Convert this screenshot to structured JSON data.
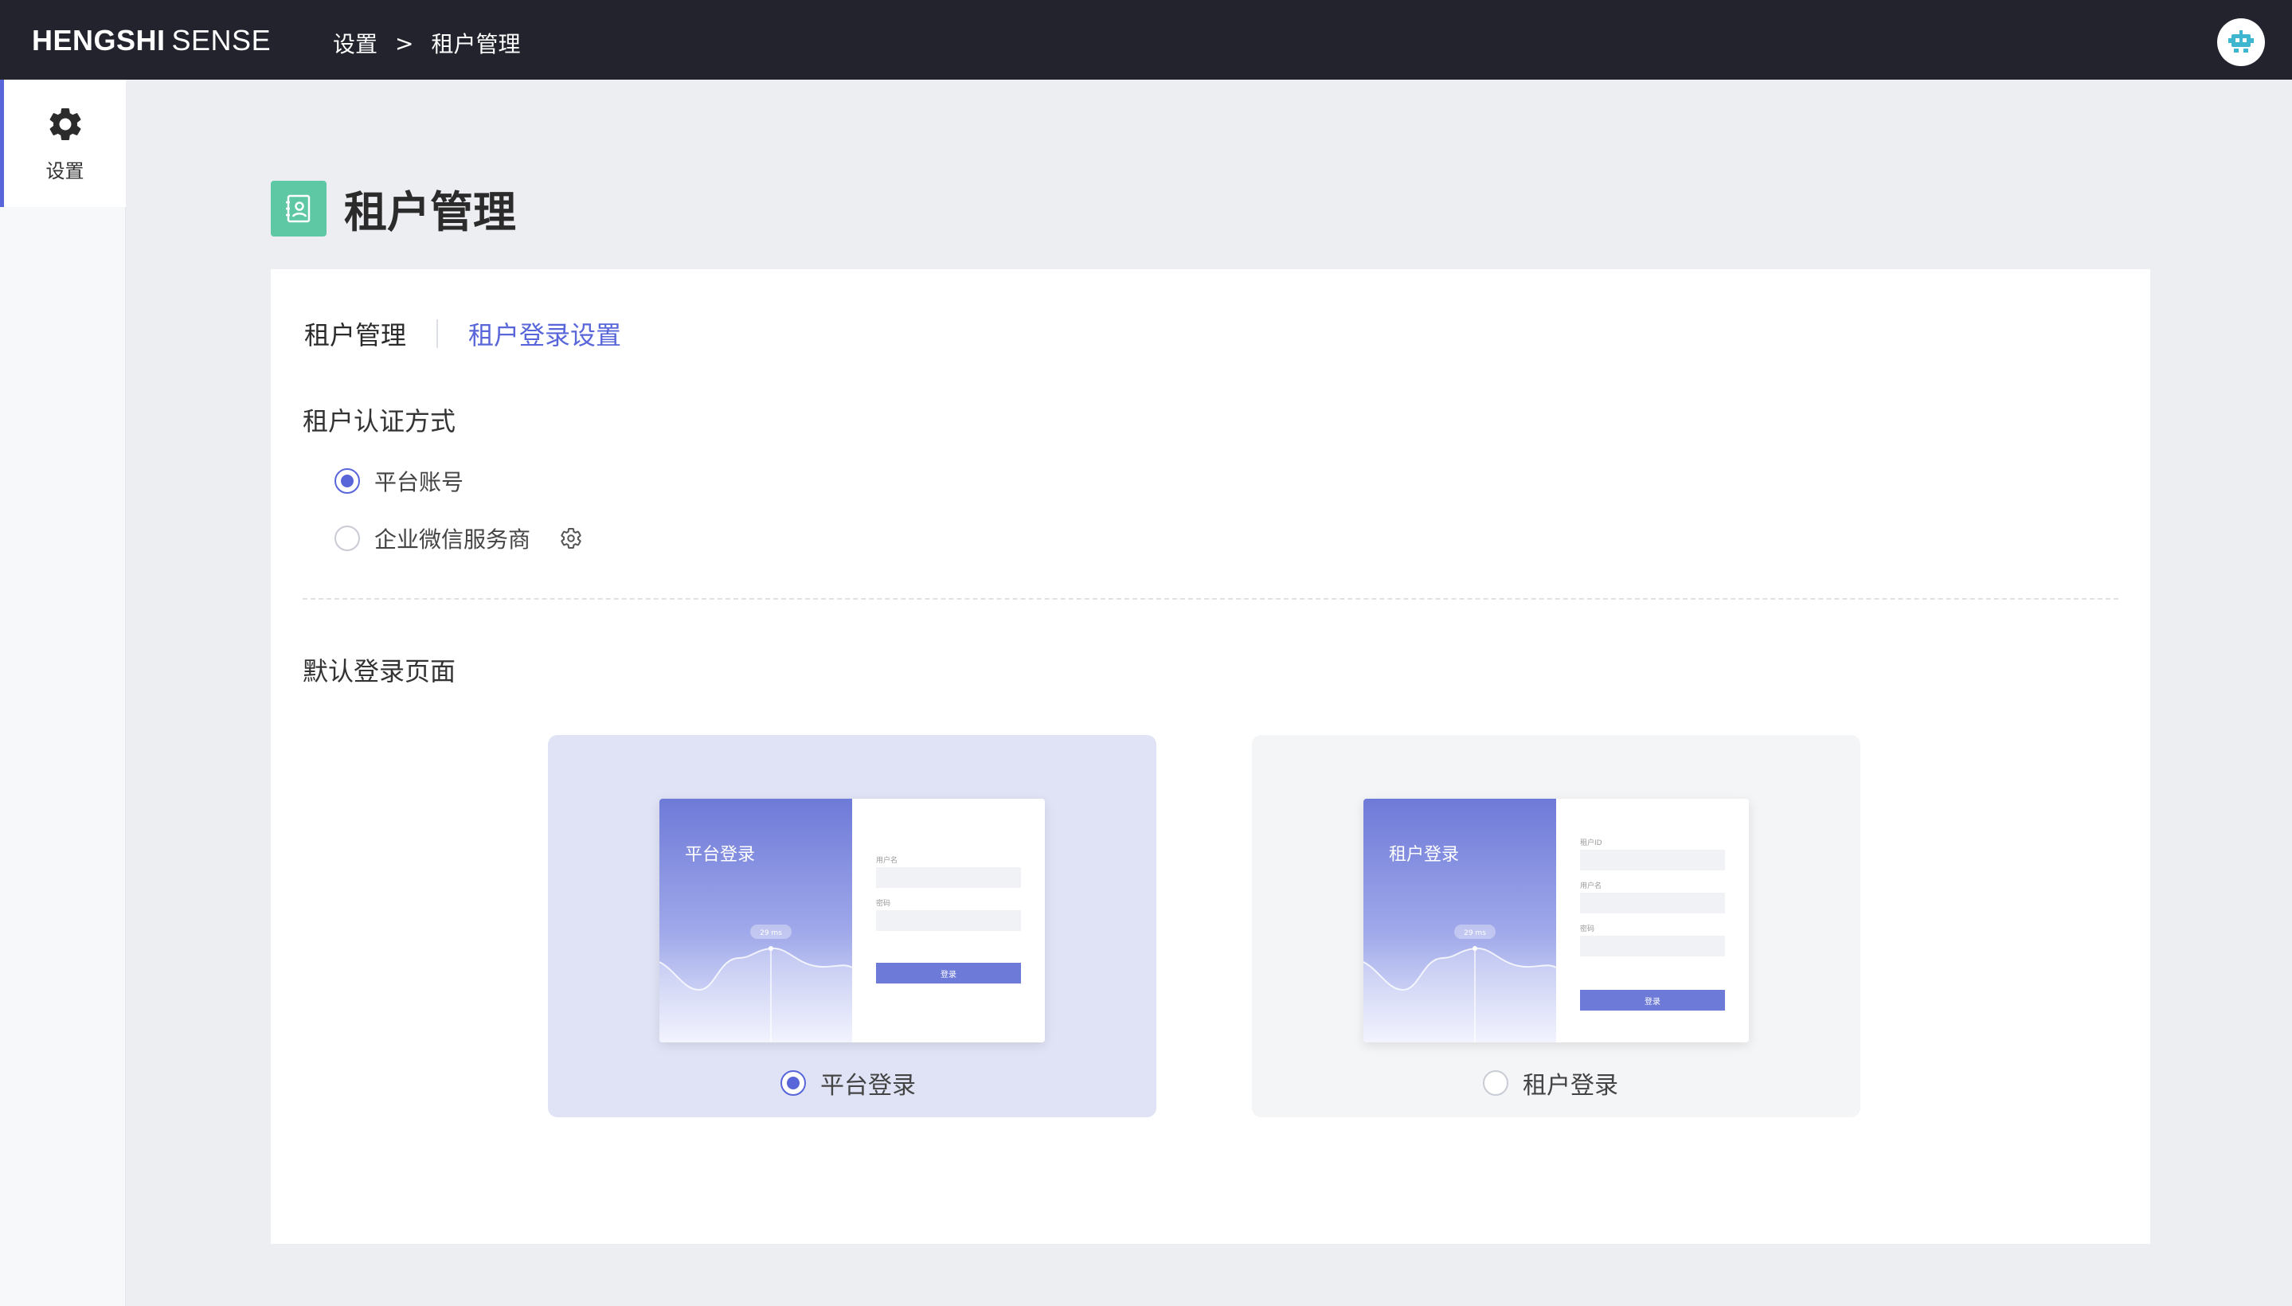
{
  "topbar": {
    "brand_bold": "HENGSHI",
    "brand_light": "SENSE",
    "breadcrumb": [
      "设置",
      "租户管理"
    ],
    "breadcrumb_sep": ">"
  },
  "leftnav": {
    "items": [
      {
        "label": "设置",
        "icon": "gear-icon",
        "active": true
      }
    ]
  },
  "page": {
    "title": "租户管理",
    "tabs": [
      {
        "label": "租户管理",
        "active": true
      },
      {
        "label": "租户登录设置",
        "active": false
      }
    ]
  },
  "auth": {
    "title": "租户认证方式",
    "options": [
      {
        "label": "平台账号",
        "checked": true
      },
      {
        "label": "企业微信服务商",
        "checked": false
      }
    ]
  },
  "login_page": {
    "title": "默认登录页面",
    "options": [
      {
        "label": "平台登录",
        "checked": true,
        "preview_title": "平台登录",
        "chart_badge": "29 ms",
        "fields": [
          "用户名",
          "密码"
        ],
        "button": "登录"
      },
      {
        "label": "租户登录",
        "checked": false,
        "preview_title": "租户登录",
        "chart_badge": "29 ms",
        "fields": [
          "租户ID",
          "用户名",
          "密码"
        ],
        "button": "登录"
      }
    ]
  },
  "colors": {
    "accent": "#5866d9",
    "topbar_bg": "#22232d",
    "title_icon_bg": "#5ec7a4",
    "selected_panel_bg": "#dfe3f5"
  }
}
